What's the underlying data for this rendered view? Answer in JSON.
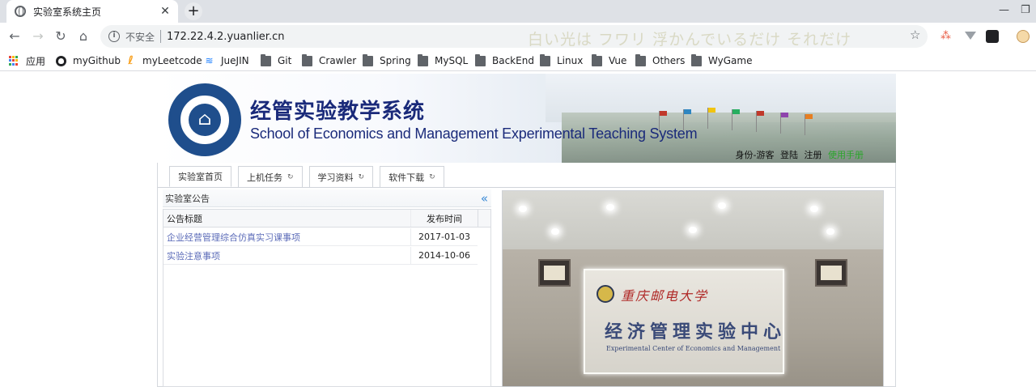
{
  "browser": {
    "tab_title": "实验室系统主页",
    "url": "172.22.4.2.yuanlier.cn",
    "security_label": "不安全",
    "marquee_text": "白い光は フワリ 浮かんでいるだけ それだけ",
    "bookmarks": [
      {
        "label": "应用",
        "icon": "apps-icon"
      },
      {
        "label": "myGithub",
        "icon": "github-icon"
      },
      {
        "label": "myLeetcode",
        "icon": "leetcode-icon"
      },
      {
        "label": "JueJIN",
        "icon": "juejin-icon"
      },
      {
        "label": "Git",
        "icon": "folder-icon"
      },
      {
        "label": "Crawler",
        "icon": "folder-icon"
      },
      {
        "label": "Spring",
        "icon": "folder-icon"
      },
      {
        "label": "MySQL",
        "icon": "folder-icon"
      },
      {
        "label": "BackEnd",
        "icon": "folder-icon"
      },
      {
        "label": "Linux",
        "icon": "folder-icon"
      },
      {
        "label": "Vue",
        "icon": "folder-icon"
      },
      {
        "label": "Others",
        "icon": "folder-icon"
      },
      {
        "label": "WyGame",
        "icon": "folder-icon"
      }
    ]
  },
  "header": {
    "title_cn": "经管实验教学系统",
    "title_en": "School of Economics and Management Experimental Teaching System",
    "user_links": {
      "identity": "身份-游客",
      "login": "登陆",
      "register": "注册",
      "manual": "使用手册"
    }
  },
  "nav_tabs": [
    {
      "label": "实验室首页",
      "active": true
    },
    {
      "label": "上机任务",
      "active": false
    },
    {
      "label": "学习资料",
      "active": false
    },
    {
      "label": "软件下载",
      "active": false
    }
  ],
  "notice": {
    "panel_title": "实验室公告",
    "columns": [
      "公告标题",
      "发布时间"
    ],
    "rows": [
      {
        "title": "企业经营管理综合仿真实习课事项",
        "date": "2017-01-03"
      },
      {
        "title": "实验注意事项",
        "date": "2014-10-06"
      }
    ]
  },
  "photo": {
    "university": "重庆邮电大学",
    "center_cn": "经济管理实验中心",
    "center_en": "Experimental Center of Economics and Management"
  },
  "colors": {
    "title_blue": "#1a2a7a",
    "manual_green": "#2aa52a",
    "link_blue": "#5b6bb8"
  }
}
